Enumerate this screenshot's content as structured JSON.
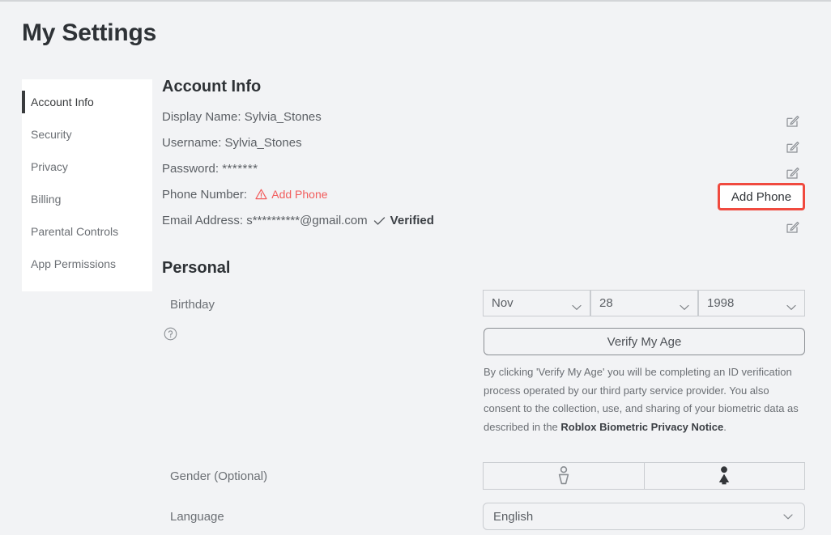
{
  "page": {
    "title": "My Settings"
  },
  "sidebar": {
    "items": [
      {
        "label": "Account Info",
        "active": true
      },
      {
        "label": "Security",
        "active": false
      },
      {
        "label": "Privacy",
        "active": false
      },
      {
        "label": "Billing",
        "active": false
      },
      {
        "label": "Parental Controls",
        "active": false
      },
      {
        "label": "App Permissions",
        "active": false
      }
    ]
  },
  "account_info": {
    "heading": "Account Info",
    "display_name_label": "Display Name: ",
    "display_name_value": "Sylvia_Stones",
    "username_label": "Username: ",
    "username_value": "Sylvia_Stones",
    "password_label": "Password: ",
    "password_value": "*******",
    "phone_label": "Phone Number: ",
    "phone_add_link": "Add Phone",
    "email_label": "Email Address: ",
    "email_value": "s**********@gmail.com",
    "email_status": "Verified",
    "add_phone_button": "Add Phone",
    "edit_icon_name": "edit-pencil-icon",
    "warning_icon_name": "warning-triangle-icon",
    "check_icon_name": "check-icon"
  },
  "personal": {
    "heading": "Personal",
    "birthday_label": "Birthday",
    "birthday_month": "Nov",
    "birthday_day": "28",
    "birthday_year": "1998",
    "verify_age_button": "Verify My Age",
    "disclaimer_part1": "By clicking 'Verify My Age' you will be completing an ID verification process operated by our third party service provider. You also consent to the collection, use, and sharing of your biometric data as described in the ",
    "disclaimer_link": "Roblox Biometric Privacy Notice",
    "disclaimer_part2": ".",
    "gender_label": "Gender (Optional)",
    "gender_option_male": "male-gender-icon",
    "gender_option_female": "female-gender-icon",
    "gender_selected": "female",
    "language_label": "Language",
    "language_value": "English",
    "help_icon_name": "help-circle-icon"
  },
  "colors": {
    "background": "#f2f3f5",
    "card": "#ffffff",
    "accent_red": "#f25c5c",
    "highlight_border": "#f04a3f",
    "text_dark": "#2e3236",
    "text_muted": "#6b6f74",
    "border": "#c9ccd0"
  }
}
